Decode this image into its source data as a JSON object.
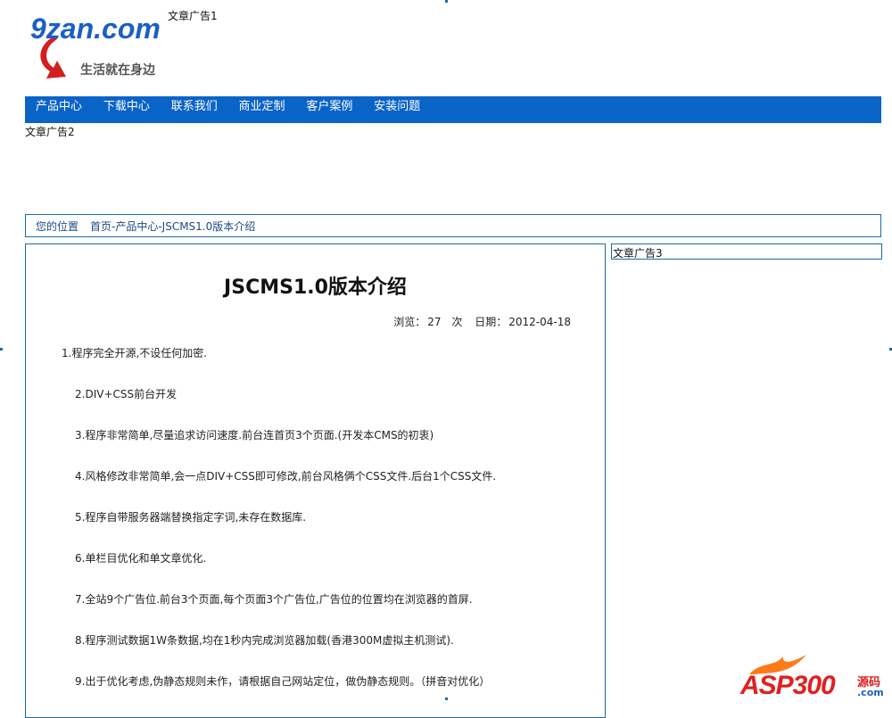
{
  "logo": {
    "site": "9zan.com",
    "slogan": "生活就在身边"
  },
  "ads": {
    "ad1": "文章广告1",
    "ad2": "文章广告2",
    "ad3": "文章广告3"
  },
  "nav": {
    "items": [
      "产品中心",
      "下载中心",
      "联系我们",
      "商业定制",
      "客户案例",
      "安装问题"
    ]
  },
  "breadcrumb": {
    "label": "您的位置",
    "path": "首页-产品中心-JSCMS1.0版本介绍"
  },
  "article": {
    "title": "JSCMS1.0版本介绍",
    "views_label": "浏览：",
    "views": "27",
    "views_unit": "次",
    "date_label": "日期：",
    "date": "2012-04-18",
    "paragraphs": [
      "1.程序完全开源,不设任何加密.",
      "2.DIV+CSS前台开发",
      "3.程序非常简单,尽量追求访问速度.前台连首页3个页面.(开发本CMS的初衷)",
      "4.风格修改非常简单,会一点DIV+CSS即可修改,前台风格俩个CSS文件.后台1个CSS文件.",
      "5.程序自带服务器端替换指定字词,未存在数据库.",
      "6.单栏目优化和单文章优化.",
      "7.全站9个广告位.前台3个页面,每个页面3个广告位,广告位的位置均在浏览器的首屏.",
      "8.程序测试数据1W条数据,均在1秒内完成浏览器加载(香港300M虚拟主机测试).",
      "9.出于优化考虑,伪静态规则未作，请根据自己网站定位，做伪静态规则。（拼音对优化）"
    ]
  },
  "watermark": {
    "brand": "ASP300",
    "sub": "源码",
    "domain": ".com"
  },
  "colors": {
    "nav_bg": "#0a64c8",
    "border": "#1a6aa8",
    "logo": "#1a5fc6",
    "watermark": "#e02020"
  }
}
